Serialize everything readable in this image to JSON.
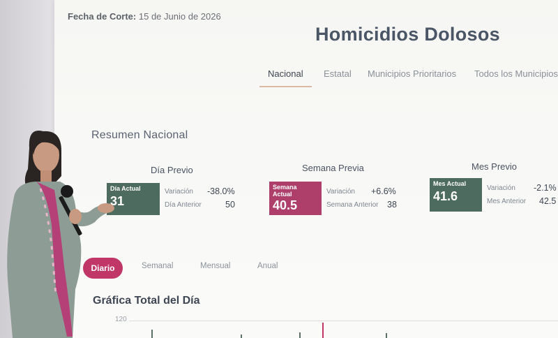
{
  "header": {
    "cutoff_label": "Fecha de Corte:",
    "cutoff_date": "15 de Junio de 2026",
    "title": "Homicidios Dolosos"
  },
  "tabs": [
    {
      "label": "Nacional",
      "active": true
    },
    {
      "label": "Estatal",
      "active": false
    },
    {
      "label": "Municipios Prioritarios",
      "active": false
    },
    {
      "label": "Todos los Municipios",
      "active": false
    }
  ],
  "summary": {
    "title": "Resumen Nacional",
    "cards": [
      {
        "title": "Día Previo",
        "badge_label": "Día Actual",
        "badge_value": "31",
        "badge_color": "#4d6b5f",
        "variation_label": "Variación",
        "variation_value": "-38.0%",
        "previous_label": "Día Anterior",
        "previous_value": "50"
      },
      {
        "title": "Semana Previa",
        "badge_label": "Semana Actual",
        "badge_value": "40.5",
        "badge_color": "#ad3f6a",
        "variation_label": "Variación",
        "variation_value": "+6.6%",
        "previous_label": "Semana Anterior",
        "previous_value": "38"
      },
      {
        "title": "Mes Previo",
        "badge_label": "Mes Actual",
        "badge_value": "41.6",
        "badge_color": "#4d6b5f",
        "variation_label": "Variación",
        "variation_value": "-2.1%",
        "previous_label": "Mes Anterior",
        "previous_value": "42.5"
      }
    ]
  },
  "periods": [
    {
      "label": "Diario",
      "active": true
    },
    {
      "label": "Semanal",
      "active": false
    },
    {
      "label": "Mensual",
      "active": false
    },
    {
      "label": "Anual",
      "active": false
    }
  ],
  "chart": {
    "title": "Gráfica Total del Día",
    "y_tick": "120"
  },
  "colors": {
    "accent_pink": "#c03767",
    "accent_green": "#4d6b5f",
    "title": "#4a5566"
  }
}
